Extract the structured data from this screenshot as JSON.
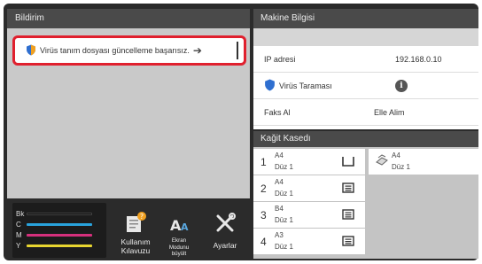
{
  "notification": {
    "title": "Bildirim",
    "message": "Virüs tanım dosyası güncelleme başarısız.",
    "arrow": "➔"
  },
  "machine_info": {
    "title": "Makine Bilgisi",
    "rows": [
      {
        "label": "IP adresi",
        "value": "192.168.0.10"
      },
      {
        "label": "Virüs Taraması",
        "value": "i"
      },
      {
        "label": "Faks Al",
        "value": "Elle Alim"
      }
    ]
  },
  "paper_tray": {
    "title": "Kağit Kasedı",
    "trays": [
      {
        "num": "1",
        "size": "A4",
        "type": "Düz 1"
      },
      {
        "num": "2",
        "size": "A4",
        "type": "Düz 1"
      },
      {
        "num": "3",
        "size": "B4",
        "type": "Düz 1"
      },
      {
        "num": "4",
        "size": "A3",
        "type": "Düz 1"
      }
    ],
    "bypass": {
      "size": "A4",
      "type": "Düz 1"
    }
  },
  "toner": [
    {
      "label": "Bk",
      "color": "#1a1a1a"
    },
    {
      "label": "C",
      "color": "#29a3dd"
    },
    {
      "label": "M",
      "color": "#d6307c"
    },
    {
      "label": "Y",
      "color": "#e8d630"
    }
  ],
  "bottom_buttons": {
    "guide": "Kullanım Kılavuzu",
    "display_line1": "Ekran",
    "display_line2": "Modunu",
    "display_line3": "büyült",
    "settings": "Ayarlar"
  },
  "icons": {
    "shield": "shield-icon",
    "info": "info-icon",
    "guide": "book-icon",
    "display": "font-size-icon",
    "settings": "tools-icon"
  }
}
